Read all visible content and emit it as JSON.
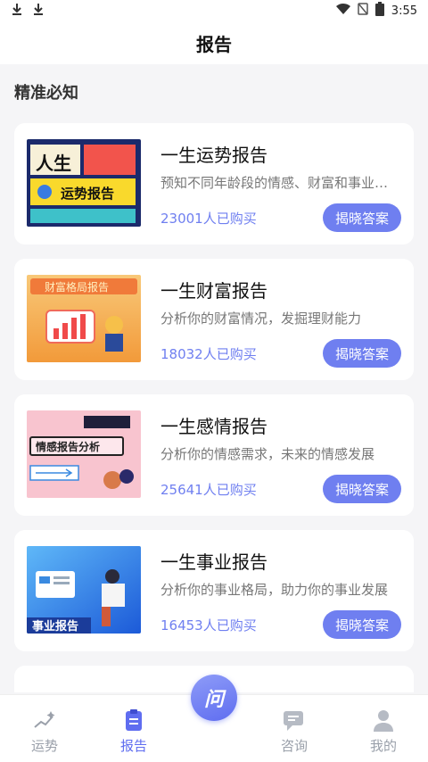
{
  "status": {
    "time": "3:55"
  },
  "header": {
    "title": "报告"
  },
  "section": {
    "title": "精准必知"
  },
  "cards": [
    {
      "title": "一生运势报告",
      "desc": "预知不同年龄段的情感、财富和事业…",
      "count": "23001人已购买",
      "button": "揭晓答案",
      "thumb_text": "人生 运势报告"
    },
    {
      "title": "一生财富报告",
      "desc": "分析你的财富情况，发掘理财能力",
      "count": "18032人已购买",
      "button": "揭晓答案",
      "thumb_text": "财富格局报告"
    },
    {
      "title": "一生感情报告",
      "desc": "分析你的情感需求，未来的情感发展",
      "count": "25641人已购买",
      "button": "揭晓答案",
      "thumb_text": "情感报告分析"
    },
    {
      "title": "一生事业报告",
      "desc": "分析你的事业格局，助力你的事业发展",
      "count": "16453人已购买",
      "button": "揭晓答案",
      "thumb_text": "事业报告"
    }
  ],
  "tabbar": {
    "center": "问",
    "tabs": [
      {
        "label": "运势"
      },
      {
        "label": "报告"
      },
      {
        "label": "咨询"
      },
      {
        "label": "我的"
      }
    ]
  },
  "colors": {
    "accent": "#6f7ff0",
    "active_tab": "#5f6df0"
  }
}
